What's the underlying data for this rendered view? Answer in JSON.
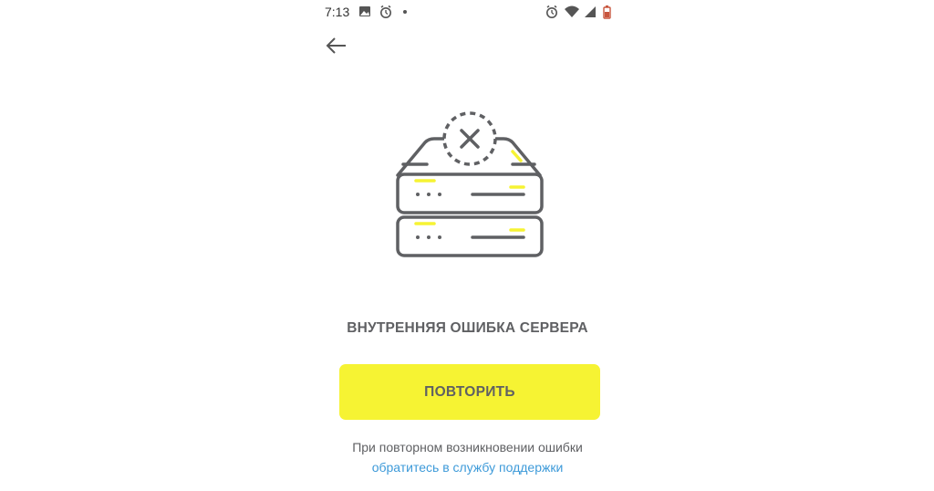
{
  "status_bar": {
    "time": "7:13",
    "left_icons": [
      "image-icon",
      "alarm-icon",
      "dot-icon"
    ],
    "right_icons": [
      "alarm-icon",
      "wifi-icon",
      "signal-icon",
      "battery-icon"
    ]
  },
  "navigation": {
    "back_icon": "arrow-left-icon"
  },
  "illustration": {
    "icon": "server-error-icon",
    "accent_color": "#f6f333",
    "stroke_color": "#5f6063"
  },
  "error": {
    "title": "ВНУТРЕННЯЯ ОШИБКА СЕРВЕРА"
  },
  "actions": {
    "retry_label": "ПОВТОРИТЬ",
    "button_color": "#f6f333"
  },
  "help": {
    "text": "При повторном возникновении ошибки",
    "link": "обратитесь в службу поддержки",
    "link_color": "#3d9ad9"
  }
}
